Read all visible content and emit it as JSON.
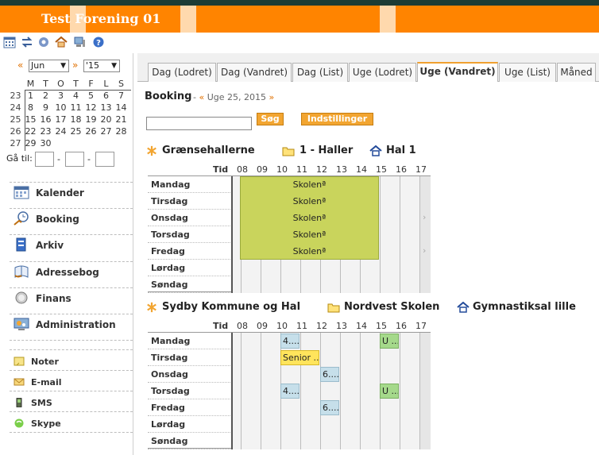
{
  "app": {
    "title": "Test Forening 01"
  },
  "toolbar": {
    "icons": [
      "calendar-icon",
      "swap-icon",
      "settings-icon",
      "home-icon",
      "computer-icon",
      "help-icon"
    ]
  },
  "calendar": {
    "prev": "«",
    "next": "»",
    "month": "Jun",
    "year": "'15",
    "weekday_headers": [
      "M",
      "T",
      "O",
      "T",
      "F",
      "L",
      "S"
    ],
    "weeks": [
      {
        "wk": "23",
        "days": [
          "1",
          "2",
          "3",
          "4",
          "5",
          "6",
          "7"
        ]
      },
      {
        "wk": "24",
        "days": [
          "8",
          "9",
          "10",
          "11",
          "12",
          "13",
          "14"
        ]
      },
      {
        "wk": "25",
        "days": [
          "15",
          "16",
          "17",
          "18",
          "19",
          "20",
          "21"
        ]
      },
      {
        "wk": "26",
        "days": [
          "22",
          "23",
          "24",
          "25",
          "26",
          "27",
          "28"
        ]
      },
      {
        "wk": "27",
        "days": [
          "29",
          "30",
          "",
          "",
          "",
          "",
          ""
        ]
      }
    ],
    "goto_label": "Gå til:",
    "goto_sep": "-"
  },
  "menu": {
    "main": [
      {
        "id": "kalender",
        "label": "Kalender",
        "icon": "calendar-icon"
      },
      {
        "id": "booking",
        "label": "Booking",
        "icon": "booking-icon"
      },
      {
        "id": "arkiv",
        "label": "Arkiv",
        "icon": "archive-icon"
      },
      {
        "id": "adressebog",
        "label": "Adressebog",
        "icon": "address-book-icon"
      },
      {
        "id": "finans",
        "label": "Finans",
        "icon": "finance-icon"
      },
      {
        "id": "administration",
        "label": "Administration",
        "icon": "admin-icon"
      }
    ],
    "secondary": [
      {
        "id": "noter",
        "label": "Noter",
        "icon": "notes-icon"
      },
      {
        "id": "email",
        "label": "E-mail",
        "icon": "email-icon"
      },
      {
        "id": "sms",
        "label": "SMS",
        "icon": "phone-icon"
      },
      {
        "id": "skype",
        "label": "Skype",
        "icon": "skype-icon"
      }
    ]
  },
  "tabs": [
    {
      "label": "Dag (Lodret)",
      "active": false
    },
    {
      "label": "Dag (Vandret)",
      "active": false
    },
    {
      "label": "Dag (List)",
      "active": false
    },
    {
      "label": "Uge (Lodret)",
      "active": false
    },
    {
      "label": "Uge (Vandret)",
      "active": true
    },
    {
      "label": "Uge (List)",
      "active": false
    },
    {
      "label": "Måned",
      "active": false
    }
  ],
  "booking": {
    "title": "Booking",
    "dash": "-",
    "week_prev": "«",
    "week_label": "Uge 25, 2015",
    "week_next": "»",
    "search_value": "",
    "search_button": "Søg",
    "settings_button": "Indstillinger"
  },
  "grid_common": {
    "tid_label": "Tid",
    "hours": [
      "08",
      "09",
      "10",
      "11",
      "12",
      "13",
      "14",
      "15",
      "16",
      "17"
    ],
    "days": [
      "Mandag",
      "Tirsdag",
      "Onsdag",
      "Torsdag",
      "Fredag",
      "Lørdag",
      "Søndag"
    ]
  },
  "sections": [
    {
      "venue": "Grænsehallerne",
      "group": "1 - Haller",
      "hall": "Hal 1",
      "bookings": [
        {
          "day": 0,
          "label": "Skolenª",
          "color": "green-block"
        },
        {
          "day": 1,
          "label": "Skolenª",
          "color": "green-block"
        },
        {
          "day": 2,
          "label": "Skolenª",
          "color": "green-block"
        },
        {
          "day": 3,
          "label": "Skolenª",
          "color": "green-block"
        },
        {
          "day": 4,
          "label": "Skolenª",
          "color": "green-block"
        }
      ]
    },
    {
      "venue": "Sydby Kommune og Hal",
      "group": "Nordvest Skolen",
      "hall": "Gymnastiksal lille",
      "bookings": [
        {
          "day": 0,
          "start": 10,
          "end": 11,
          "label": "4....",
          "color": "blue"
        },
        {
          "day": 0,
          "start": 15,
          "end": 16,
          "label": "U ...",
          "color": "green"
        },
        {
          "day": 1,
          "start": 10,
          "end": 12,
          "label": "Senior ...",
          "color": "yellow"
        },
        {
          "day": 2,
          "start": 12,
          "end": 13,
          "label": "6....",
          "color": "blue"
        },
        {
          "day": 3,
          "start": 10,
          "end": 11,
          "label": "4....",
          "color": "blue"
        },
        {
          "day": 3,
          "start": 15,
          "end": 16,
          "label": "U ...",
          "color": "green"
        },
        {
          "day": 4,
          "start": 12,
          "end": 13,
          "label": "6....",
          "color": "blue"
        }
      ]
    }
  ]
}
